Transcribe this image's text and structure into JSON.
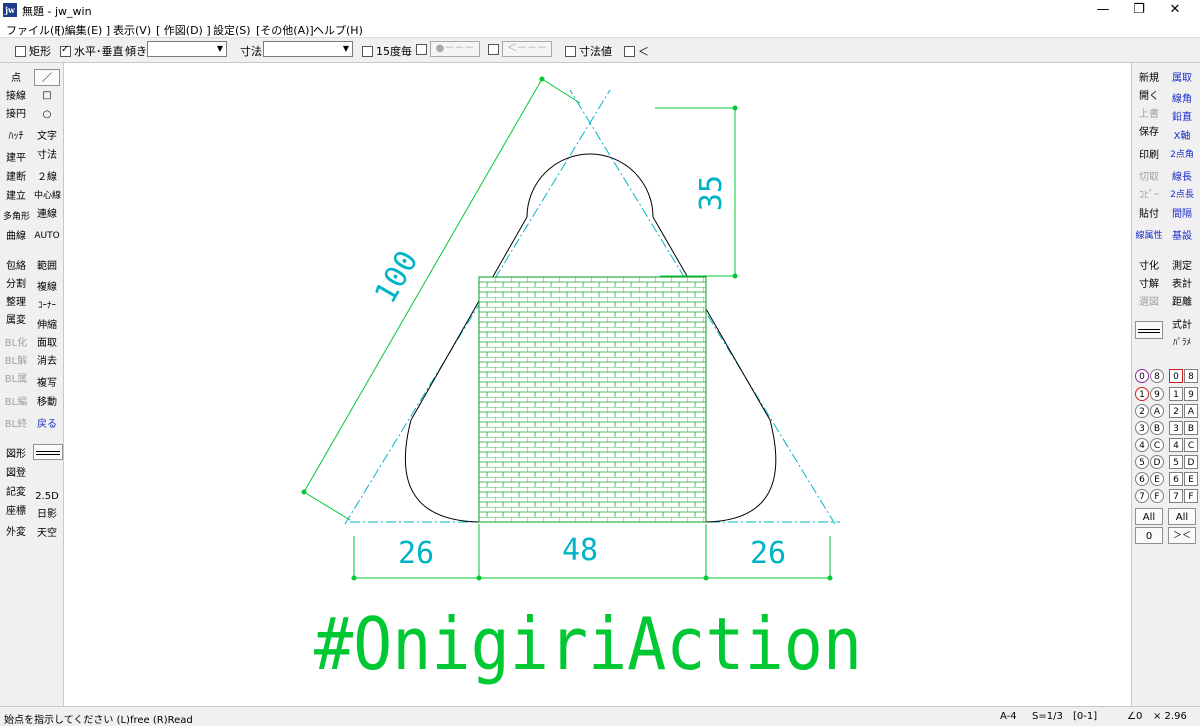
{
  "window": {
    "icon_text": "jw",
    "title": "無題 - jw_win",
    "minimize": "—",
    "maximize": "❐",
    "close": "✕"
  },
  "menu": [
    "ファイル(F)",
    "[ 編集(E) ]",
    "表示(V)",
    "[ 作図(D) ]",
    "設定(S)",
    "[その他(A)]",
    "ヘルプ(H)"
  ],
  "toolbar": {
    "rect_label": "矩形",
    "ortho_label": "水平･垂直",
    "tilt_label": "傾き",
    "tilt_value": "",
    "dim_label": "寸法",
    "dim_value": "",
    "deg15_label": "15度毎",
    "btn1": "●－－－",
    "btn2": "＜－－－",
    "dimval_label": "寸法値",
    "lt_label": "＜"
  },
  "left_tools": {
    "col1": [
      "点",
      "接線",
      "接円",
      "ﾊｯﾁ",
      "建平",
      "建断",
      "建立",
      "多角形",
      "曲線",
      "包絡",
      "分割",
      "整理",
      "属変",
      "BL化",
      "BL解",
      "BL属",
      "BL編",
      "BL終",
      "図形",
      "図登",
      "記変",
      "座標",
      "外変"
    ],
    "col2": [
      "／",
      "□",
      "○",
      "文字",
      "寸法",
      "２線",
      "中心線",
      "連線",
      "AUTO",
      "範囲",
      "複線",
      "ｺｰﾅｰ",
      "伸縮",
      "面取",
      "消去",
      "複写",
      "移動",
      "戻る",
      "",
      "2.5D",
      "日影",
      "天空"
    ]
  },
  "right_tools": {
    "col1": [
      "新規",
      "開く",
      "上書",
      "保存",
      "印刷",
      "切取",
      "ｺﾋﾟｰ",
      "貼付",
      "線属性",
      "寸化",
      "寸解",
      "選図",
      "",
      "",
      ""
    ],
    "col2": [
      "属取",
      "線角",
      "鉛直",
      "X軸",
      "2点角",
      "線長",
      "2点長",
      "間隔",
      "基設",
      "測定",
      "表計",
      "距離",
      "式計",
      "ﾊﾟﾗﾒ"
    ]
  },
  "layers": {
    "group_left": [
      "0",
      "1",
      "2",
      "3",
      "4",
      "5",
      "6",
      "7"
    ],
    "group_left2": [
      "8",
      "9",
      "A",
      "B",
      "C",
      "D",
      "E",
      "F"
    ],
    "group_right": [
      "0",
      "1",
      "2",
      "3",
      "4",
      "5",
      "6",
      "7"
    ],
    "group_right2": [
      "8",
      "9",
      "A",
      "B",
      "C",
      "D",
      "E",
      "F"
    ],
    "all_left": "All",
    "all_right": "All",
    "zero": "0",
    "cross": "＞＜"
  },
  "drawing": {
    "dim_side": "100",
    "dim_height": "35",
    "dim_left": "26",
    "dim_center": "48",
    "dim_right": "26",
    "hashtag": "#OnigiriAction"
  },
  "colors": {
    "cyan": "#00b4c8",
    "green": "#00c832",
    "hatch": "#00a020"
  },
  "status": {
    "message": "始点を指示してください (L)free (R)Read",
    "paper": "A-4",
    "scale": "S=1/3",
    "layer": "[0-1]",
    "angle": "∠0",
    "zoom": "× 2.96"
  }
}
